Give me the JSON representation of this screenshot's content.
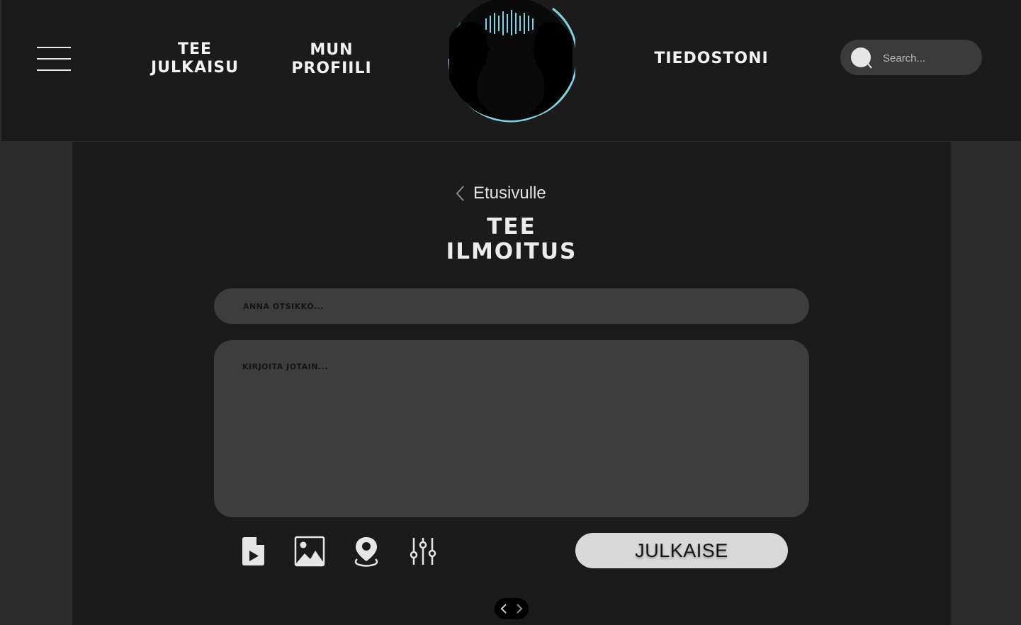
{
  "header": {
    "nav": {
      "post": [
        "TEE",
        "JULKAISU"
      ],
      "profile": [
        "MUN",
        "PROFIILI"
      ],
      "files": "TIEDOSTONI"
    },
    "search": {
      "placeholder": "Search..."
    }
  },
  "main": {
    "back_label": "Etusivulle",
    "title": [
      "TEE",
      "ILMOITUS"
    ],
    "title_input": {
      "placeholder": "ANNA OTSIKKO...",
      "value": ""
    },
    "body_input": {
      "placeholder": "KIRJOITA JOTAIN...",
      "value": ""
    },
    "toolbar_icons": [
      "video-file-icon",
      "image-icon",
      "location-pin-icon",
      "sliders-icon"
    ],
    "publish_label": "JULKAISE"
  },
  "colors": {
    "header_bg": "#1b1b1b",
    "page_bg": "#2c2c2c",
    "field_bg": "#3d3d3d",
    "logo_accent": "#7fd3e6",
    "publish_bg": "#d9d9d9"
  }
}
